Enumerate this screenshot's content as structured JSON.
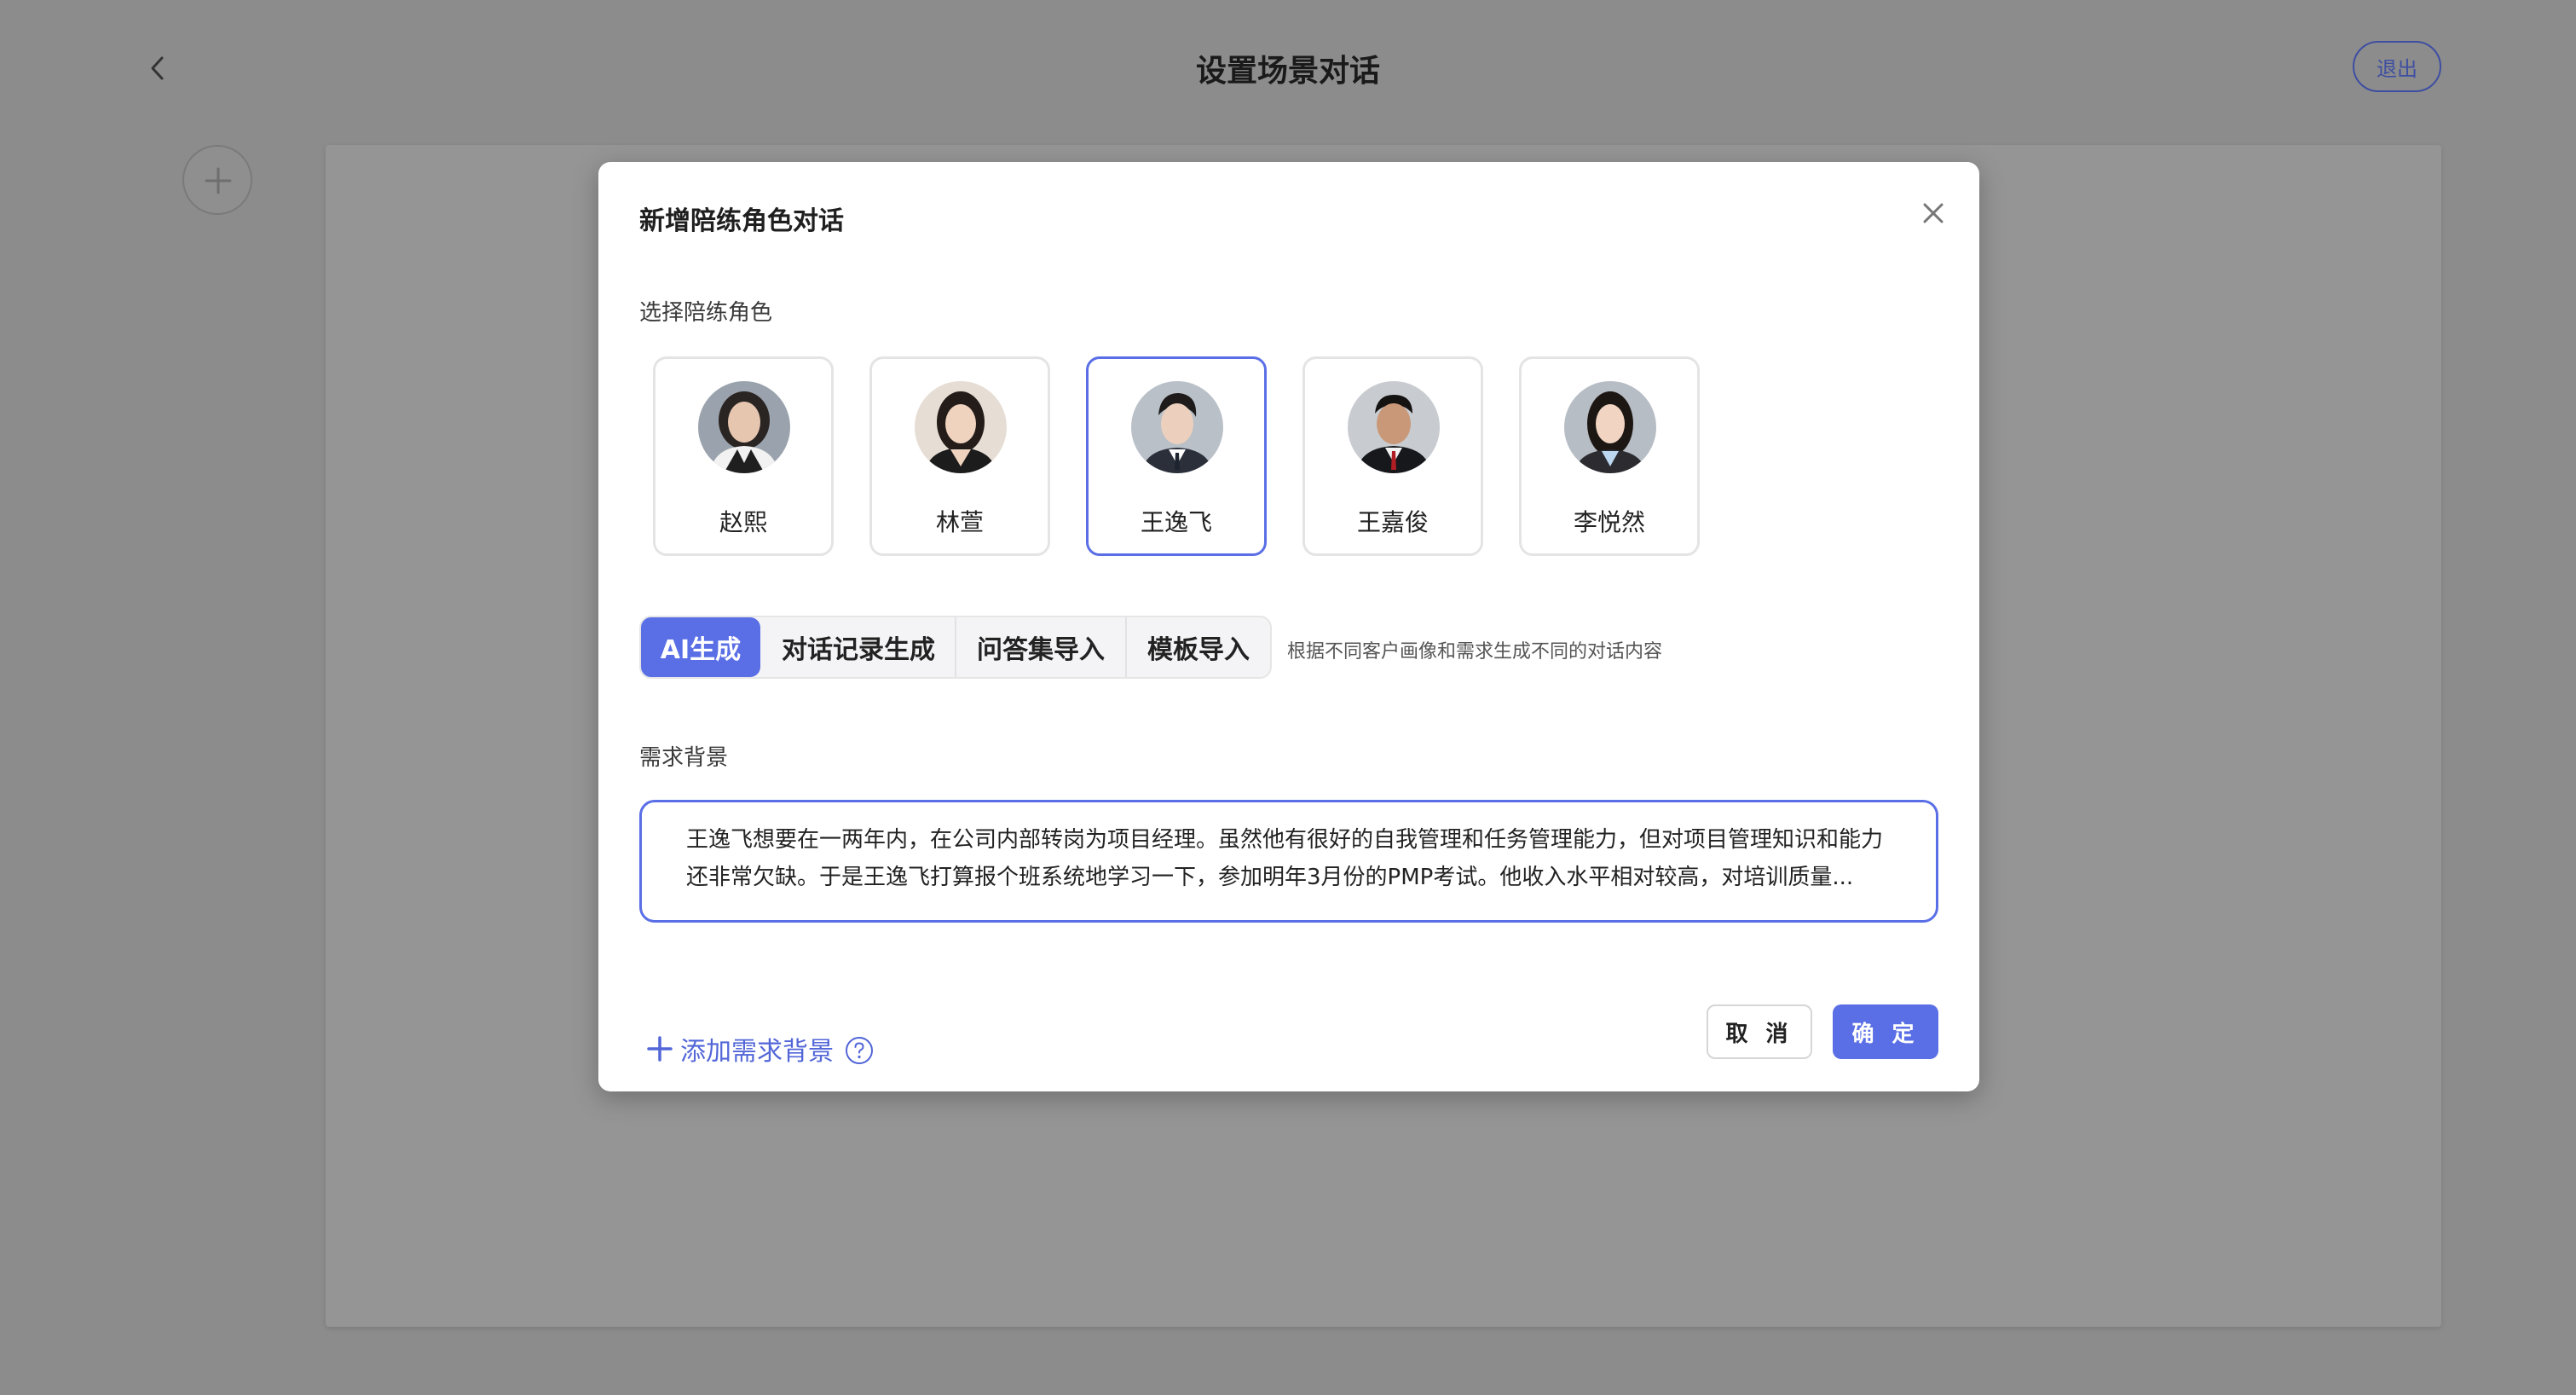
{
  "header": {
    "title": "设置场景对话",
    "exit_label": "退出"
  },
  "modal": {
    "title": "新增陪练角色对话",
    "role_section_label": "选择陪练角色",
    "roles": [
      {
        "name": "赵熙",
        "avatar": "woman-portrait-icon",
        "selected": false
      },
      {
        "name": "林萱",
        "avatar": "woman-portrait-icon",
        "selected": false
      },
      {
        "name": "王逸飞",
        "avatar": "man-portrait-icon",
        "selected": true
      },
      {
        "name": "王嘉俊",
        "avatar": "man-portrait-icon",
        "selected": false
      },
      {
        "name": "李悦然",
        "avatar": "woman-portrait-icon",
        "selected": false
      }
    ],
    "tabs": [
      {
        "label": "AI生成",
        "active": true
      },
      {
        "label": "对话记录生成",
        "active": false
      },
      {
        "label": "问答集导入",
        "active": false
      },
      {
        "label": "模板导入",
        "active": false
      }
    ],
    "tab_hint": "根据不同客户画像和需求生成不同的对话内容",
    "background_label": "需求背景",
    "background_text": "王逸飞想要在一两年内，在公司内部转岗为项目经理。虽然他有很好的自我管理和任务管理能力，但对项目管理知识和能力还非常欠缺。于是王逸飞打算报个班系统地学习一下，参加明年3月份的PMP考试。他收入水平相对较高，对培训质量...",
    "add_background_label": "添加需求背景",
    "cancel_label": "取 消",
    "confirm_label": "确 定"
  },
  "colors": {
    "accent": "#5a6fe6",
    "overlay": "#8c8c8c",
    "link": "#5266d8"
  }
}
